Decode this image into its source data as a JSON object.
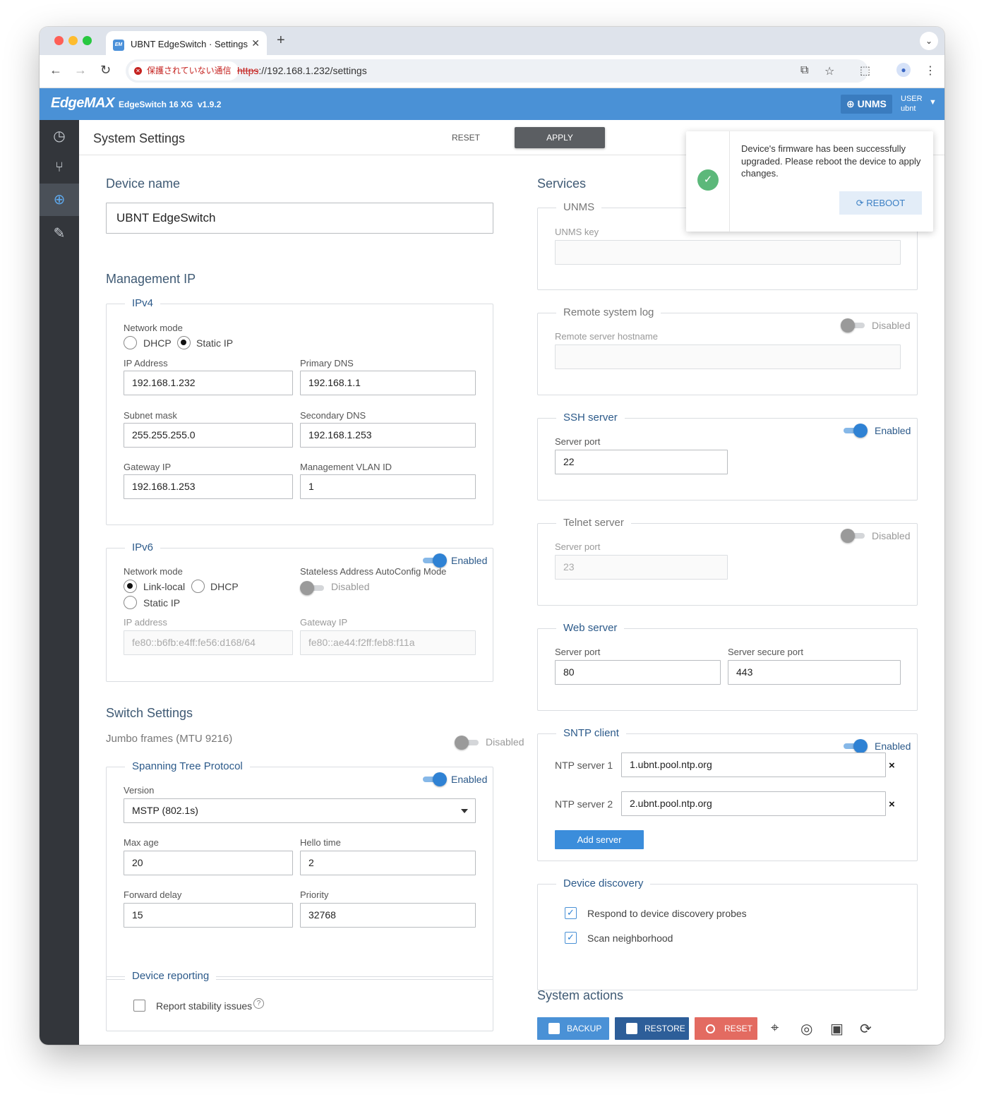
{
  "browser": {
    "tab_title": "UBNT EdgeSwitch · Settings",
    "tab_favicon": "EM",
    "new_tab": "+",
    "security_chip": "保護されていない通信",
    "url_scheme": "https",
    "url_rest": "://192.168.1.232/settings"
  },
  "app": {
    "logo": "EdgeMAX",
    "device_model": "EdgeSwitch 16 XG",
    "version": "v1.9.2",
    "unms_button": "UNMS",
    "user_label": "USER",
    "user_name": "ubnt"
  },
  "sidebar": [
    "dashboard-icon",
    "topology-icon",
    "settings-globe-icon",
    "tools-icon"
  ],
  "page": {
    "title": "System Settings",
    "reset": "RESET",
    "apply": "APPLY"
  },
  "device_name": {
    "heading": "Device name",
    "value": "UBNT EdgeSwitch"
  },
  "management_ip": {
    "heading": "Management IP",
    "ipv4": {
      "legend": "IPv4",
      "network_mode_label": "Network mode",
      "mode_dhcp": "DHCP",
      "mode_static": "Static IP",
      "ip_label": "IP Address",
      "ip_value": "192.168.1.232",
      "pdns_label": "Primary DNS",
      "pdns_value": "192.168.1.1",
      "mask_label": "Subnet mask",
      "mask_value": "255.255.255.0",
      "sdns_label": "Secondary DNS",
      "sdns_value": "192.168.1.253",
      "gw_label": "Gateway IP",
      "gw_value": "192.168.1.253",
      "vlan_label": "Management VLAN ID",
      "vlan_value": "1"
    },
    "ipv6": {
      "legend": "IPv6",
      "toggle_label": "Enabled",
      "network_mode_label": "Network mode",
      "mode_linklocal": "Link-local",
      "mode_dhcp": "DHCP",
      "mode_static": "Static IP",
      "slaac_label": "Stateless Address AutoConfig Mode",
      "slaac_toggle": "Disabled",
      "ip_label": "IP address",
      "ip_value": "fe80::b6fb:e4ff:fe56:d168/64",
      "gw_label": "Gateway IP",
      "gw_value": "fe80::ae44:f2ff:feb8:f11a"
    }
  },
  "switch_settings": {
    "heading": "Switch Settings",
    "jumbo_label": "Jumbo frames (MTU 9216)",
    "jumbo_toggle": "Disabled",
    "stp": {
      "legend": "Spanning Tree Protocol",
      "toggle_label": "Enabled",
      "version_label": "Version",
      "version_value": "MSTP (802.1s)",
      "maxage_label": "Max age",
      "maxage_value": "20",
      "hello_label": "Hello time",
      "hello_value": "2",
      "fwd_label": "Forward delay",
      "fwd_value": "15",
      "prio_label": "Priority",
      "prio_value": "32768"
    },
    "reporting": {
      "legend": "Device reporting",
      "stability_label": "Report stability issues",
      "help": "?"
    }
  },
  "services": {
    "heading": "Services",
    "unms": {
      "legend": "UNMS",
      "key_label": "UNMS key",
      "key_value": ""
    },
    "syslog": {
      "legend": "Remote system log",
      "toggle": "Disabled",
      "host_label": "Remote server hostname",
      "host_value": ""
    },
    "ssh": {
      "legend": "SSH server",
      "toggle": "Enabled",
      "port_label": "Server port",
      "port_value": "22"
    },
    "telnet": {
      "legend": "Telnet server",
      "toggle": "Disabled",
      "port_label": "Server port",
      "port_value": "23"
    },
    "web": {
      "legend": "Web server",
      "port_label": "Server port",
      "port_value": "80",
      "secure_label": "Server secure port",
      "secure_value": "443"
    },
    "sntp": {
      "legend": "SNTP client",
      "toggle": "Enabled",
      "ntp1_label": "NTP server 1",
      "ntp1_value": "1.ubnt.pool.ntp.org",
      "ntp2_label": "NTP server 2",
      "ntp2_value": "2.ubnt.pool.ntp.org",
      "remove": "×",
      "add_button": "Add server"
    },
    "discovery": {
      "legend": "Device discovery",
      "respond_label": "Respond to device discovery probes",
      "scan_label": "Scan neighborhood",
      "check": "✓"
    }
  },
  "system_actions": {
    "heading": "System actions",
    "backup": "BACKUP",
    "restore": "RESTORE",
    "reset": "RESET",
    "icons": [
      "locate-icon",
      "support-icon",
      "chip-icon",
      "reboot-icon"
    ]
  },
  "toast": {
    "message": "Device's firmware has been successfully upgraded. Please reboot the device to apply changes.",
    "reboot": "REBOOT",
    "ok": "✓"
  },
  "colors": {
    "header_blue": "#4a91d6",
    "sidebar_dark": "#33363b",
    "accent_blue": "#2f82d4",
    "reset_red": "#e36b61",
    "restore_navy": "#2d5e99"
  }
}
